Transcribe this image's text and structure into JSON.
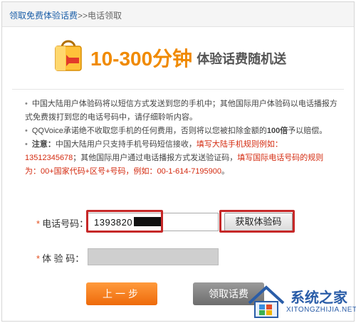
{
  "breadcrumb": {
    "link": "领取免费体验话费",
    "separator": ">>",
    "current": "电话领取"
  },
  "banner": {
    "headline": "10-300分钟",
    "subline": "体验话费随机送",
    "icon": "shopping-bag-icon"
  },
  "notes": {
    "item1": "中国大陆用户体验码将以短信方式发送到您的手机中；其他国际用户体验码以电话播报方式免费拨打到您的电话号码中，请仔细聆听内容。",
    "item2_a": "QQVoice承诺绝不收取您手机的任何费用，否则将以您被扣除金额的",
    "item2_b": "100倍",
    "item2_c": "予以赔偿。",
    "item3_label": "注意：",
    "item3_a": "中国大陆用户只支持手机号码短信接收，",
    "item3_b": "填写大陆手机规则例如：13512345678",
    "item3_c": "；其他国际用户通过电话播报方式发送验证码，",
    "item3_d": "填写国际电话号码的规则为：00+国家代码+区号+号码，例如：00-1-614-7195900",
    "item3_e": "。"
  },
  "form": {
    "required_mark": "*",
    "phone_label": "电话号码：",
    "phone_value": "1393820",
    "get_code_button": "获取体验码",
    "code_label": "体 验 码：",
    "code_value": ""
  },
  "buttons": {
    "prev": "上一步",
    "get": "领取话费"
  },
  "watermark": {
    "title": "系统之家",
    "url": "XITONGZHIJIA.NET"
  },
  "colors": {
    "accent_orange": "#f08a00",
    "highlight_red": "#c62828",
    "text_red": "#d42b10",
    "brand_blue": "#2a5da8"
  }
}
